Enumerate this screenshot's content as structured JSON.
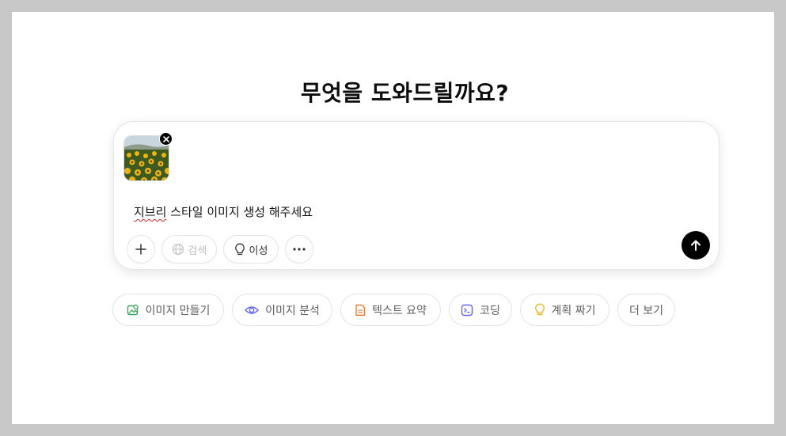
{
  "heading": "무엇을 도와드릴까요?",
  "composer": {
    "attachment": {
      "kind": "image",
      "description_icon": "sunflower-field-thumbnail"
    },
    "prompt_misspelled_word": "지브리",
    "prompt_rest": " 스타일 이미지 생성 해주세요",
    "toolbar": {
      "attach_icon": "plus-icon",
      "search_label": "검색",
      "reason_label": "이성",
      "more_icon": "ellipsis-icon"
    }
  },
  "suggestions": [
    {
      "label": "이미지 만들기",
      "icon": "image-create-icon",
      "color": "#34a853"
    },
    {
      "label": "이미지 분석",
      "icon": "eye-icon",
      "color": "#6366f1"
    },
    {
      "label": "텍스트 요약",
      "icon": "document-icon",
      "color": "#f07b3f"
    },
    {
      "label": "코딩",
      "icon": "terminal-icon",
      "color": "#6366f1"
    },
    {
      "label": "계획 짜기",
      "icon": "lightbulb-icon",
      "color": "#e8b923"
    },
    {
      "label": "더 보기",
      "icon": "",
      "color": ""
    }
  ]
}
